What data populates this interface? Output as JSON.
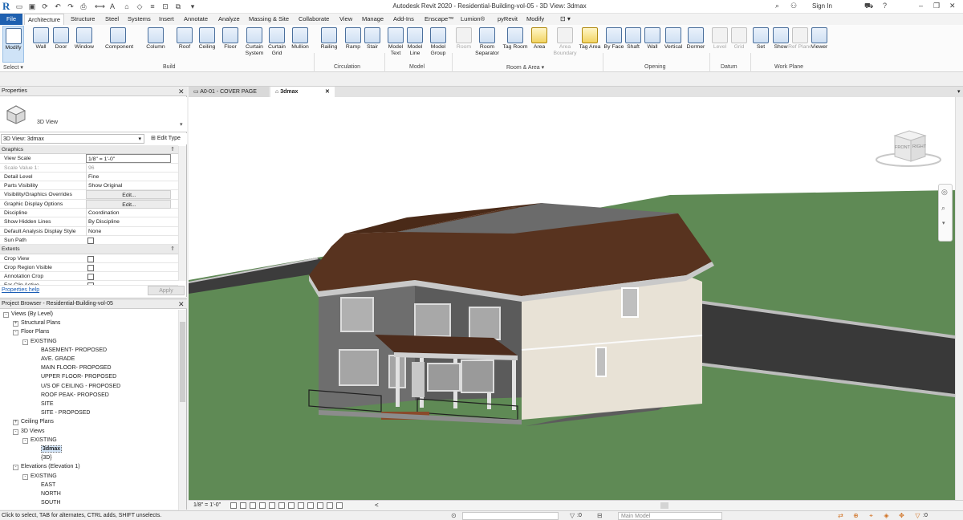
{
  "app": {
    "logo": "R",
    "window_title": "Autodesk Revit 2020 - Residential-Building-vol-05 - 3D View: 3dmax",
    "signin": "Sign In"
  },
  "tabs": [
    "File",
    "Architecture",
    "Structure",
    "Steel",
    "Systems",
    "Insert",
    "Annotate",
    "Analyze",
    "Massing & Site",
    "Collaborate",
    "View",
    "Manage",
    "Add-Ins",
    "Enscape™",
    "Lumion®",
    "pyRevit",
    "Modify"
  ],
  "ribbon": {
    "modify": {
      "label": "Modify",
      "panel": "Select ▾"
    },
    "build": {
      "panel": "Build",
      "buttons": [
        "Wall",
        "Door",
        "Window",
        "Component",
        "Column",
        "Roof",
        "Ceiling",
        "Floor",
        "Curtain System",
        "Curtain Grid",
        "Mullion"
      ]
    },
    "circulation": {
      "panel": "Circulation",
      "buttons": [
        "Railing",
        "Ramp",
        "Stair"
      ]
    },
    "model": {
      "panel": "Model",
      "buttons": [
        "Model Text",
        "Model Line",
        "Model Group"
      ]
    },
    "room_area": {
      "panel": "Room & Area ▾",
      "buttons": [
        "Room",
        "Room Separator",
        "Tag Room",
        "Area",
        "Area Boundary",
        "Tag Area"
      ]
    },
    "opening": {
      "panel": "Opening",
      "buttons": [
        "By Face",
        "Shaft",
        "Wall",
        "Vertical",
        "Dormer"
      ]
    },
    "datum": {
      "panel": "Datum",
      "buttons": [
        "Level",
        "Grid"
      ]
    },
    "work_plane": {
      "panel": "Work Plane",
      "buttons": [
        "Set",
        "Show",
        "Ref Plane",
        "Viewer"
      ]
    }
  },
  "properties": {
    "title": "Properties",
    "type_name": "3D View",
    "instance": "3D View: 3dmax",
    "edit_type": "Edit Type",
    "sections": [
      {
        "name": "Graphics",
        "rows": [
          {
            "key": "View Scale",
            "value": "1/8\" = 1'-0\"",
            "kind": "input"
          },
          {
            "key": "Scale Value    1:",
            "value": "96",
            "kind": "dim"
          },
          {
            "key": "Detail Level",
            "value": "Fine",
            "kind": "text"
          },
          {
            "key": "Parts Visibility",
            "value": "Show Original",
            "kind": "text"
          },
          {
            "key": "Visibility/Graphics Overrides",
            "value": "Edit...",
            "kind": "button"
          },
          {
            "key": "Graphic Display Options",
            "value": "Edit...",
            "kind": "button"
          },
          {
            "key": "Discipline",
            "value": "Coordination",
            "kind": "text"
          },
          {
            "key": "Show Hidden Lines",
            "value": "By Discipline",
            "kind": "text"
          },
          {
            "key": "Default Analysis Display Style",
            "value": "None",
            "kind": "text"
          },
          {
            "key": "Sun Path",
            "value": "",
            "kind": "check"
          }
        ]
      },
      {
        "name": "Extents",
        "rows": [
          {
            "key": "Crop View",
            "value": "",
            "kind": "check"
          },
          {
            "key": "Crop Region Visible",
            "value": "",
            "kind": "check"
          },
          {
            "key": "Annotation Crop",
            "value": "",
            "kind": "check"
          },
          {
            "key": "Far Clip Active",
            "value": "",
            "kind": "check"
          }
        ]
      }
    ],
    "help": "Properties help",
    "apply": "Apply"
  },
  "browser": {
    "title": "Project Browser - Residential-Building-vol-05",
    "nodes": [
      {
        "label": "Views (By Level)",
        "depth": 0,
        "toggle": "-"
      },
      {
        "label": "Structural Plans",
        "depth": 1,
        "toggle": "+"
      },
      {
        "label": "Floor Plans",
        "depth": 1,
        "toggle": "-"
      },
      {
        "label": "EXISTING",
        "depth": 2,
        "toggle": "-"
      },
      {
        "label": "BASEMENT- PROPOSED",
        "depth": 3,
        "toggle": ""
      },
      {
        "label": "AVE. GRADE",
        "depth": 3,
        "toggle": ""
      },
      {
        "label": "MAIN FLOOR- PROPOSED",
        "depth": 3,
        "toggle": ""
      },
      {
        "label": "UPPER FLOOR- PROPOSED",
        "depth": 3,
        "toggle": ""
      },
      {
        "label": "U/S OF CEILING - PROPOSED",
        "depth": 3,
        "toggle": ""
      },
      {
        "label": "ROOF PEAK- PROPOSED",
        "depth": 3,
        "toggle": ""
      },
      {
        "label": "SITE",
        "depth": 3,
        "toggle": ""
      },
      {
        "label": "SITE - PROPOSED",
        "depth": 3,
        "toggle": ""
      },
      {
        "label": "Ceiling Plans",
        "depth": 1,
        "toggle": "+"
      },
      {
        "label": "3D Views",
        "depth": 1,
        "toggle": "-"
      },
      {
        "label": "EXISTING",
        "depth": 2,
        "toggle": "-"
      },
      {
        "label": "3dmax",
        "depth": 3,
        "toggle": "",
        "selected": true
      },
      {
        "label": "{3D}",
        "depth": 3,
        "toggle": ""
      },
      {
        "label": "Elevations (Elevation 1)",
        "depth": 1,
        "toggle": "-"
      },
      {
        "label": "EXISTING",
        "depth": 2,
        "toggle": "-"
      },
      {
        "label": "EAST",
        "depth": 3,
        "toggle": ""
      },
      {
        "label": "NORTH",
        "depth": 3,
        "toggle": ""
      },
      {
        "label": "SOUTH",
        "depth": 3,
        "toggle": ""
      }
    ]
  },
  "doc_tabs": [
    {
      "label": "A0-01 - COVER PAGE",
      "close": "✕"
    },
    {
      "label": "3dmax",
      "close": "✕"
    }
  ],
  "viewcube": {
    "front": "FRONT",
    "right": "RIGHT"
  },
  "view_control": {
    "scale": "1/8\" = 1'-0\""
  },
  "status": {
    "text": "Click to select, TAB for alternates, CTRL adds, SHIFT unselects.",
    "count": ":0",
    "model": "Main Model"
  },
  "colors": {
    "accent": "#1e60b0",
    "ground": "#5f8a55",
    "roof": "#5a3524",
    "road": "#3a3a3a"
  }
}
